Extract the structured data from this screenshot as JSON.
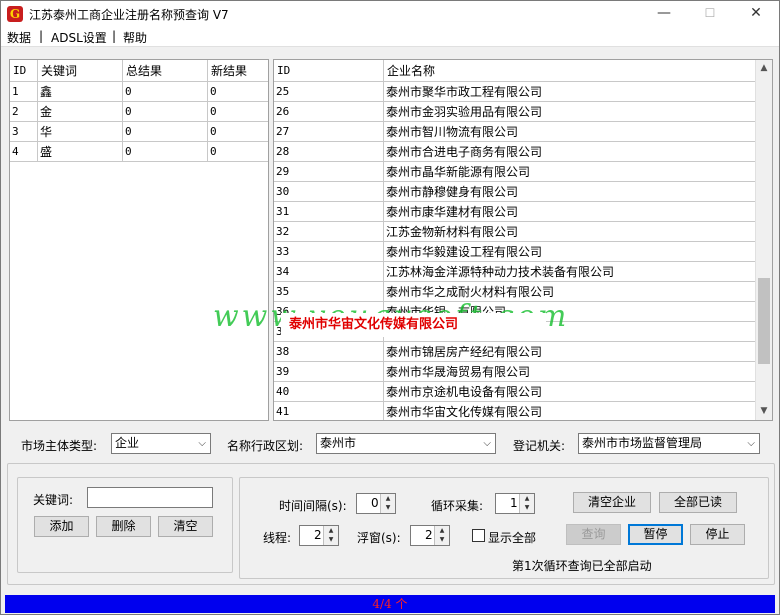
{
  "window": {
    "title": "江苏泰州工商企业注册名称预查询 V7",
    "minimize": "—",
    "maximize": "☐",
    "close": "✕"
  },
  "menu": {
    "items": [
      "数据",
      "|",
      "ADSL设置",
      "|",
      "帮助"
    ]
  },
  "keywords_table": {
    "headers": [
      "ID",
      "关键词",
      "总结果",
      "新结果"
    ],
    "rows": [
      [
        "1",
        "鑫",
        "0",
        "0"
      ],
      [
        "2",
        "金",
        "0",
        "0"
      ],
      [
        "3",
        "华",
        "0",
        "0"
      ],
      [
        "4",
        "盛",
        "0",
        "0"
      ]
    ]
  },
  "results_table": {
    "headers": [
      "ID",
      "企业名称"
    ],
    "rows": [
      [
        "25",
        "泰州市聚华市政工程有限公司"
      ],
      [
        "26",
        "泰州市金羽实验用品有限公司"
      ],
      [
        "27",
        "泰州市智川物流有限公司"
      ],
      [
        "28",
        "泰州市合进电子商务有限公司"
      ],
      [
        "29",
        "泰州市晶华新能源有限公司"
      ],
      [
        "30",
        "泰州市静穆健身有限公司"
      ],
      [
        "31",
        "泰州市康华建材有限公司"
      ],
      [
        "32",
        "江苏金物新材料有限公司"
      ],
      [
        "33",
        "泰州市华毅建设工程有限公司"
      ],
      [
        "34",
        "江苏林海金洋源特种动力技术装备有限公司"
      ],
      [
        "35",
        "泰州市华之成耐火材料有限公司"
      ],
      [
        "36",
        "泰州市华银…有限公司"
      ],
      [
        "37",
        ""
      ],
      [
        "38",
        "泰州市锦居房产经纪有限公司"
      ],
      [
        "39",
        "泰州市华晟海贸易有限公司"
      ],
      [
        "40",
        "泰州市京途机电设备有限公司"
      ],
      [
        "41",
        "泰州市华宙文化传媒有限公司"
      ]
    ]
  },
  "popup_text": "泰州市华宙文化传媒有限公司",
  "watermark": "www.yougusoft.com",
  "filters": {
    "market_type_label": "市场主体类型:",
    "market_type_value": "企业",
    "region_label": "名称行政区划:",
    "region_value": "泰州市",
    "authority_label": "登记机关:",
    "authority_value": "泰州市市场监督管理局"
  },
  "keyword_panel": {
    "keyword_label": "关键词:",
    "keyword_value": "",
    "add": "添加",
    "delete": "删除",
    "clear": "清空"
  },
  "control_panel": {
    "interval_label": "时间间隔(s):",
    "interval_value": "0",
    "loop_label": "循环采集:",
    "loop_value": "1",
    "threads_label": "线程:",
    "threads_value": "2",
    "popup_label": "浮窗(s):",
    "popup_value": "2",
    "show_all_label": "显示全部",
    "clear_companies": "清空企业",
    "mark_all_read": "全部已读",
    "query": "查询",
    "pause": "暂停",
    "stop": "停止",
    "status": "第1次循环查询已全部启动"
  },
  "statusbar": {
    "progress_text": "4/4 个"
  }
}
